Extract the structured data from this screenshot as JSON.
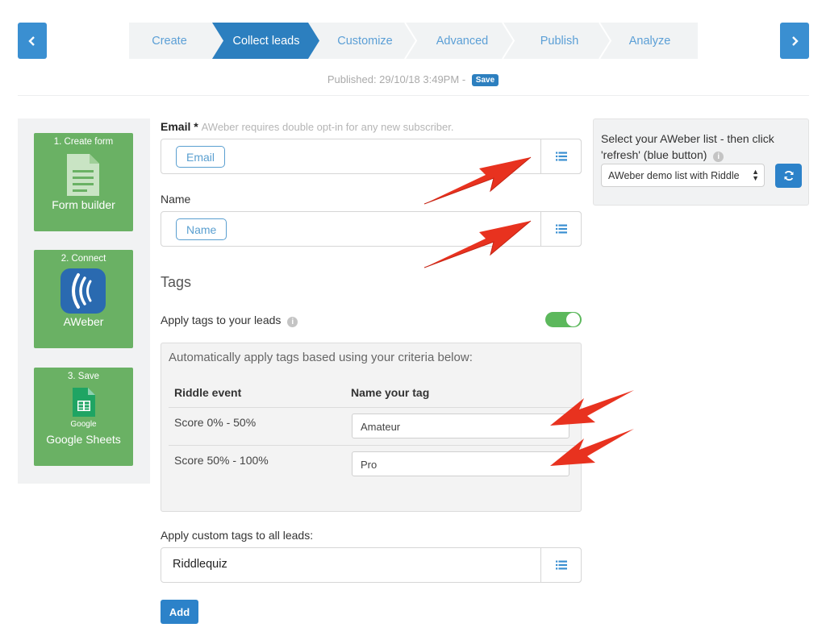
{
  "nav": {
    "prev_icon": "chevron-left-icon",
    "next_icon": "chevron-right-icon"
  },
  "steps": [
    {
      "label": "Create"
    },
    {
      "label": "Collect leads",
      "active": true
    },
    {
      "label": "Customize"
    },
    {
      "label": "Advanced"
    },
    {
      "label": "Publish"
    },
    {
      "label": "Analyze"
    }
  ],
  "status": {
    "published": "Published: 29/10/18 3:49PM",
    "separator": "-",
    "save_label": "Save"
  },
  "sidebar": {
    "items": [
      {
        "caption": "1. Create form",
        "label": "Form builder",
        "icon": "document-icon"
      },
      {
        "caption": "2. Connect",
        "label": "AWeber",
        "icon": "aweber-logo-icon"
      },
      {
        "caption": "3. Save",
        "sublabel": "Google",
        "label": "Google Sheets",
        "icon": "google-sheets-icon"
      }
    ]
  },
  "form": {
    "email": {
      "label": "Email",
      "required": "*",
      "hint": "AWeber requires double opt-in for any new subscriber.",
      "token": "Email"
    },
    "name": {
      "label": "Name",
      "token": "Name"
    },
    "tags_title": "Tags",
    "apply_tags_label": "Apply tags to your leads",
    "apply_tags_on": true,
    "tags_intro": "Automatically apply tags based using your criteria below:",
    "table": {
      "headers": [
        "Riddle event",
        "Name your tag"
      ],
      "rows": [
        {
          "event": "Score 0% - 50%",
          "tag": "Amateur"
        },
        {
          "event": "Score 50% - 100%",
          "tag": "Pro"
        }
      ]
    },
    "custom_tags_label": "Apply custom tags to all leads:",
    "custom_tags_value": "Riddlequiz",
    "add_label": "Add"
  },
  "aweber": {
    "instruction": "Select your AWeber list - then click 'refresh' (blue button)",
    "selected_list": "AWeber demo list with Riddle"
  },
  "colors": {
    "accent": "#3a8fd1",
    "active_step": "#2c7fbf",
    "green": "#6ab164",
    "arrow": "#e8321f"
  }
}
